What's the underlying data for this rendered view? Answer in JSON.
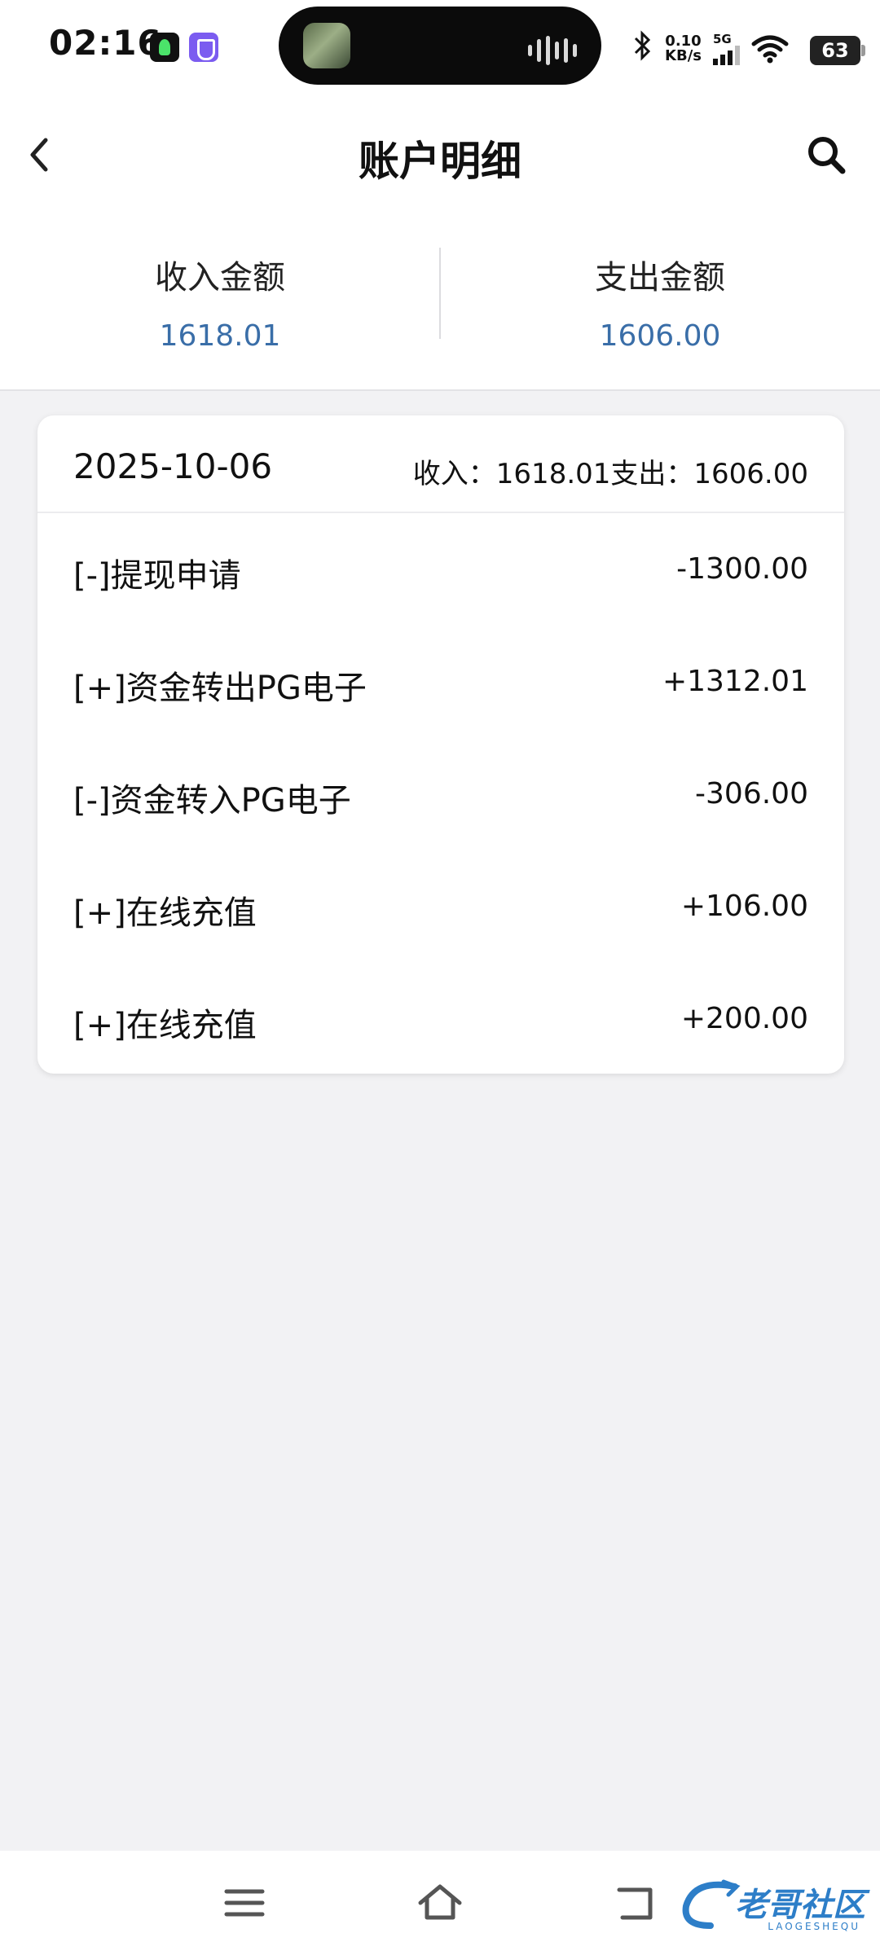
{
  "status_bar": {
    "time": "02:16",
    "net_speed_value": "0.10",
    "net_speed_unit": "KB/s",
    "signal_label": "5G",
    "battery": "63"
  },
  "header": {
    "title": "账户明细"
  },
  "summary": {
    "income_label": "收入金额",
    "income_value": "1618.01",
    "expense_label": "支出金额",
    "expense_value": "1606.00"
  },
  "day_group": {
    "date": "2025-10-06",
    "totals": "收入：1618.01支出：1606.00",
    "items": [
      {
        "label": "[-]提现申请",
        "amount": "-1300.00"
      },
      {
        "label": "[+]资金转出PG电子",
        "amount": "+1312.01"
      },
      {
        "label": "[-]资金转入PG电子",
        "amount": "-306.00"
      },
      {
        "label": "[+]在线充值",
        "amount": "+106.00"
      },
      {
        "label": "[+]在线充值",
        "amount": "+200.00"
      }
    ]
  },
  "watermark": {
    "text": "老哥社区",
    "sub": "LAOGESHEQU"
  },
  "colors": {
    "accent_blue": "#3a6ea8",
    "background": "#f2f2f4",
    "watermark": "#2d7ec8"
  }
}
